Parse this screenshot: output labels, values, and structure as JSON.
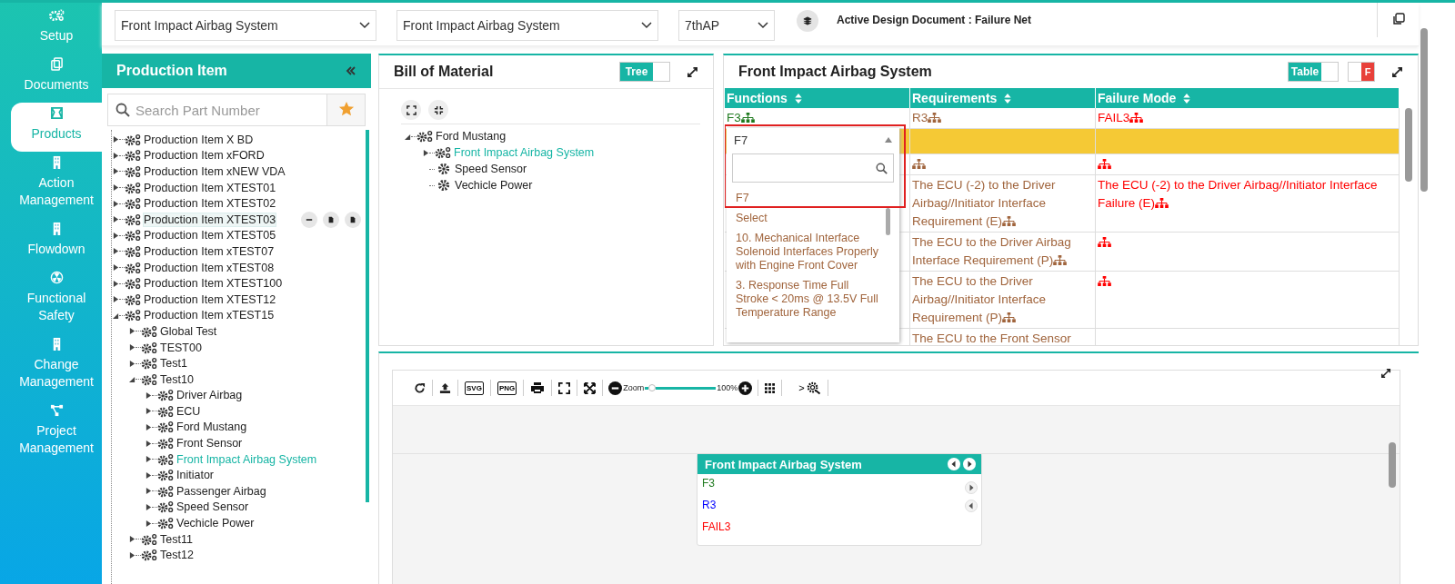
{
  "sidebar": {
    "items": [
      {
        "label": "Setup",
        "selected": false
      },
      {
        "label": "Documents",
        "selected": false
      },
      {
        "label": "Products",
        "selected": true
      },
      {
        "label": "Action Management",
        "selected": false
      },
      {
        "label": "Flowdown",
        "selected": false
      },
      {
        "label": "Functional Safety",
        "selected": false
      },
      {
        "label": "Change Management",
        "selected": false
      },
      {
        "label": "Project Management",
        "selected": false
      }
    ]
  },
  "top_bar": {
    "selects": [
      "Front Impact Airbag System",
      "Front Impact Airbag System",
      "7thAP"
    ],
    "active_document": "Active Design Document : Failure Net"
  },
  "production_item": {
    "title": "Production Item",
    "search": {
      "placeholder": "Search Part Number"
    },
    "tree": [
      {
        "label": "Production Item X BD",
        "expanded": false,
        "selected": false,
        "actions_visible": false
      },
      {
        "label": "Production Item xFORD",
        "expanded": false,
        "selected": false,
        "actions_visible": false
      },
      {
        "label": "Production Item xNEW VDA",
        "expanded": false,
        "selected": false,
        "actions_visible": false
      },
      {
        "label": "Production Item XTEST01",
        "expanded": false,
        "selected": false,
        "actions_visible": false
      },
      {
        "label": "Production Item XTEST02",
        "expanded": false,
        "selected": false,
        "actions_visible": false
      },
      {
        "label": "Production Item XTEST03",
        "expanded": false,
        "selected": false,
        "actions_visible": true
      },
      {
        "label": "Production Item XTEST05",
        "expanded": false,
        "selected": false,
        "actions_visible": false
      },
      {
        "label": "Production Item xTEST07",
        "expanded": false,
        "selected": false,
        "actions_visible": false
      },
      {
        "label": "Production Item xTEST08",
        "expanded": false,
        "selected": false,
        "actions_visible": false
      },
      {
        "label": "Production Item XTEST100",
        "expanded": false,
        "selected": false,
        "actions_visible": false
      },
      {
        "label": "Production Item XTEST12",
        "expanded": false,
        "selected": false,
        "actions_visible": false
      },
      {
        "label": "Production Item xTEST15",
        "expanded": true,
        "selected": false,
        "actions_visible": false,
        "children": [
          {
            "label": "Global Test",
            "expanded": false,
            "selected": false
          },
          {
            "label": "TEST00",
            "expanded": false,
            "selected": false
          },
          {
            "label": "Test1",
            "expanded": false,
            "selected": false
          },
          {
            "label": "Test10",
            "expanded": true,
            "selected": false,
            "children": [
              {
                "label": "Driver Airbag",
                "expanded": false,
                "selected": false
              },
              {
                "label": "ECU",
                "expanded": false,
                "selected": false
              },
              {
                "label": "Ford Mustang",
                "expanded": false,
                "selected": false
              },
              {
                "label": "Front Sensor",
                "expanded": false,
                "selected": false
              },
              {
                "label": "Front Impact Airbag System",
                "expanded": false,
                "selected": true
              },
              {
                "label": "Initiator",
                "expanded": false,
                "selected": false
              },
              {
                "label": "Passenger Airbag",
                "expanded": false,
                "selected": false
              },
              {
                "label": "Speed Sensor",
                "expanded": false,
                "selected": false
              },
              {
                "label": "Vechicle Power",
                "expanded": false,
                "selected": false
              }
            ]
          },
          {
            "label": "Test11",
            "expanded": false,
            "selected": false
          },
          {
            "label": "Test12",
            "expanded": false,
            "selected": false
          }
        ]
      }
    ]
  },
  "bill_of_material": {
    "title": "Bill of Material",
    "toggle": {
      "label": "Tree",
      "on": true
    },
    "tree": [
      {
        "label": "Ford Mustang",
        "kind": "assembly",
        "expanded": true,
        "selected": false,
        "children": [
          {
            "label": "Front Impact Airbag System",
            "kind": "assembly",
            "expanded": false,
            "selected": true
          },
          {
            "label": "Speed Sensor",
            "kind": "part",
            "selected": false
          },
          {
            "label": "Vechicle Power",
            "kind": "part",
            "selected": false
          }
        ]
      }
    ]
  },
  "failure_table": {
    "title": "Front Impact Airbag System",
    "table_toggle": {
      "label": "Table",
      "on": true
    },
    "f_toggle": {
      "label": "F",
      "on": true
    },
    "columns": [
      {
        "label": "Functions",
        "color": "#1e7a1e"
      },
      {
        "label": "Requirements",
        "color": "#a0643c"
      },
      {
        "label": "Failure Mode",
        "color": "#ff0000"
      }
    ],
    "rows": [
      {
        "selected": false,
        "cells": [
          {
            "text": "F3",
            "icon": true
          },
          {
            "text": "R3",
            "icon": true
          },
          {
            "text": "FAIL3",
            "icon": true
          }
        ]
      },
      {
        "selected": true,
        "cells": [
          {},
          {
            "icon": false
          },
          {
            "icon": false
          }
        ]
      },
      {
        "selected": false,
        "cells": [
          {},
          {
            "icon": true
          },
          {
            "icon": true
          }
        ]
      },
      {
        "selected": false,
        "cells": [
          {},
          {
            "text": "The ECU (-2) to the Driver Airbag//Initiator Interface Requirement (E)",
            "icon": true
          },
          {
            "text": "The ECU (-2) to the Driver Airbag//Initiator Interface Failure (E)",
            "icon": true
          }
        ]
      },
      {
        "selected": false,
        "cells": [
          {},
          {
            "text": "The ECU to the Driver Airbag Interface Requirement (P)",
            "icon": true
          },
          {
            "icon": true
          }
        ]
      },
      {
        "selected": false,
        "cells": [
          {},
          {
            "text": "The ECU to the Driver Airbag//Initiator Interface Requirement (P)",
            "icon": true
          },
          {
            "icon": true
          }
        ]
      },
      {
        "selected": false,
        "cells": [
          {
            "icon": false
          },
          {
            "text": "The ECU to the Front Sensor",
            "icon": false
          },
          {
            "icon": false
          }
        ]
      }
    ],
    "dropdown": {
      "value": "F7",
      "options": [
        {
          "label": "F7",
          "selected": true
        },
        {
          "label": "Select",
          "selected": false
        },
        {
          "label": "10. Mechanical Interface Solenoid Interfaces Properly with Engine Front Cover",
          "selected": false
        },
        {
          "label": "3. Response Time Full Stroke < 20ms @ 13.5V Full Temperature Range",
          "selected": false
        }
      ]
    }
  },
  "diagram": {
    "toolbar": {
      "svg_label": "SVG",
      "png_label": "PNG",
      "zoom_label": "Zoom",
      "zoom": {
        "level": 0.05
      },
      "zoom_reading": "100%",
      "more": ">"
    },
    "node": {
      "title": "Front Impact Airbag System",
      "rows": [
        {
          "text": "F3",
          "color": "#1e7a1e"
        },
        {
          "text": "R3",
          "color": "#0000ff"
        },
        {
          "text": "FAIL3",
          "color": "#ff0000"
        }
      ]
    }
  }
}
